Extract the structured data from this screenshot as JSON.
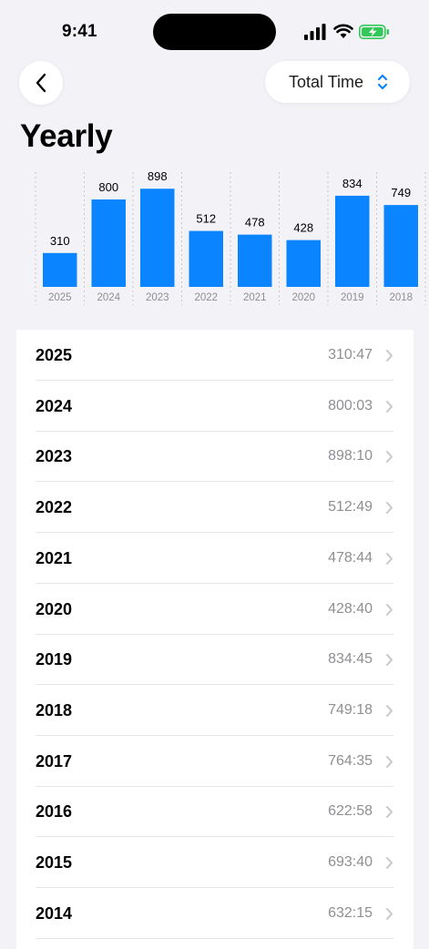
{
  "status_bar": {
    "time": "9:41"
  },
  "nav": {
    "filter_label": "Total Time"
  },
  "page": {
    "title": "Yearly"
  },
  "colors": {
    "accent": "#0a84ff",
    "battery": "#34c759"
  },
  "chart_data": {
    "type": "bar",
    "categories": [
      "2025",
      "2024",
      "2023",
      "2022",
      "2021",
      "2020",
      "2019",
      "2018"
    ],
    "values": [
      310,
      800,
      898,
      512,
      478,
      428,
      834,
      749
    ],
    "title": "",
    "xlabel": "",
    "ylabel": "",
    "ylim": [
      0,
      1000
    ],
    "grid": false
  },
  "list": {
    "rows": [
      {
        "year": "2025",
        "value": "310:47"
      },
      {
        "year": "2024",
        "value": "800:03"
      },
      {
        "year": "2023",
        "value": "898:10"
      },
      {
        "year": "2022",
        "value": "512:49"
      },
      {
        "year": "2021",
        "value": "478:44"
      },
      {
        "year": "2020",
        "value": "428:40"
      },
      {
        "year": "2019",
        "value": "834:45"
      },
      {
        "year": "2018",
        "value": "749:18"
      },
      {
        "year": "2017",
        "value": "764:35"
      },
      {
        "year": "2016",
        "value": "622:58"
      },
      {
        "year": "2015",
        "value": "693:40"
      },
      {
        "year": "2014",
        "value": "632:15"
      }
    ]
  }
}
